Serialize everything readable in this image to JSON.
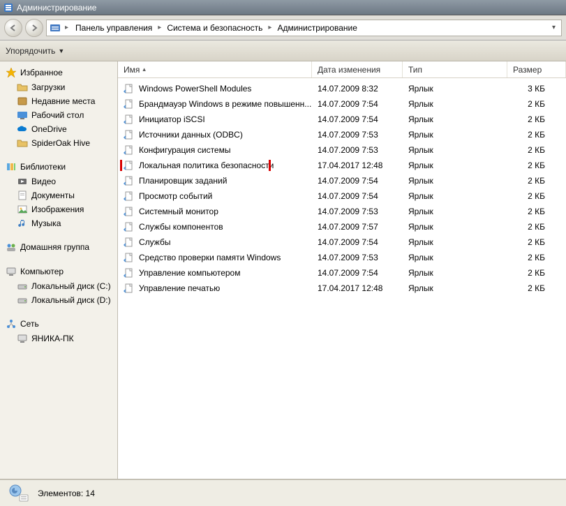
{
  "window": {
    "title": "Администрирование"
  },
  "breadcrumbs": {
    "items": [
      "Панель управления",
      "Система и безопасность",
      "Администрирование"
    ]
  },
  "organize": {
    "label": "Упорядочить"
  },
  "sidebar": {
    "favorites": {
      "header": "Избранное",
      "items": [
        "Загрузки",
        "Недавние места",
        "Рабочий стол",
        "OneDrive",
        "SpiderOak Hive"
      ]
    },
    "libraries": {
      "header": "Библиотеки",
      "items": [
        "Видео",
        "Документы",
        "Изображения",
        "Музыка"
      ]
    },
    "homegroup": {
      "header": "Домашняя группа"
    },
    "computer": {
      "header": "Компьютер",
      "items": [
        "Локальный диск (C:)",
        "Локальный диск (D:)"
      ]
    },
    "network": {
      "header": "Сеть",
      "items": [
        "ЯНИКА-ПК"
      ]
    }
  },
  "columns": {
    "name": "Имя",
    "date": "Дата изменения",
    "type": "Тип",
    "size": "Размер"
  },
  "files": [
    {
      "name": "Windows PowerShell Modules",
      "date": "14.07.2009 8:32",
      "type": "Ярлык",
      "size": "3 КБ",
      "highlight": false
    },
    {
      "name": "Брандмауэр Windows в режиме повышенн...",
      "date": "14.07.2009 7:54",
      "type": "Ярлык",
      "size": "2 КБ",
      "highlight": false
    },
    {
      "name": "Инициатор iSCSI",
      "date": "14.07.2009 7:54",
      "type": "Ярлык",
      "size": "2 КБ",
      "highlight": false
    },
    {
      "name": "Источники данных (ODBC)",
      "date": "14.07.2009 7:53",
      "type": "Ярлык",
      "size": "2 КБ",
      "highlight": false
    },
    {
      "name": "Конфигурация системы",
      "date": "14.07.2009 7:53",
      "type": "Ярлык",
      "size": "2 КБ",
      "highlight": false
    },
    {
      "name": "Локальная политика безопасности",
      "date": "17.04.2017 12:48",
      "type": "Ярлык",
      "size": "2 КБ",
      "highlight": true
    },
    {
      "name": "Планировщик заданий",
      "date": "14.07.2009 7:54",
      "type": "Ярлык",
      "size": "2 КБ",
      "highlight": false
    },
    {
      "name": "Просмотр событий",
      "date": "14.07.2009 7:54",
      "type": "Ярлык",
      "size": "2 КБ",
      "highlight": false
    },
    {
      "name": "Системный монитор",
      "date": "14.07.2009 7:53",
      "type": "Ярлык",
      "size": "2 КБ",
      "highlight": false
    },
    {
      "name": "Службы компонентов",
      "date": "14.07.2009 7:57",
      "type": "Ярлык",
      "size": "2 КБ",
      "highlight": false
    },
    {
      "name": "Службы",
      "date": "14.07.2009 7:54",
      "type": "Ярлык",
      "size": "2 КБ",
      "highlight": false
    },
    {
      "name": "Средство проверки памяти Windows",
      "date": "14.07.2009 7:53",
      "type": "Ярлык",
      "size": "2 КБ",
      "highlight": false
    },
    {
      "name": "Управление компьютером",
      "date": "14.07.2009 7:54",
      "type": "Ярлык",
      "size": "2 КБ",
      "highlight": false
    },
    {
      "name": "Управление печатью",
      "date": "17.04.2017 12:48",
      "type": "Ярлык",
      "size": "2 КБ",
      "highlight": false
    }
  ],
  "status": {
    "text": "Элементов: 14"
  }
}
